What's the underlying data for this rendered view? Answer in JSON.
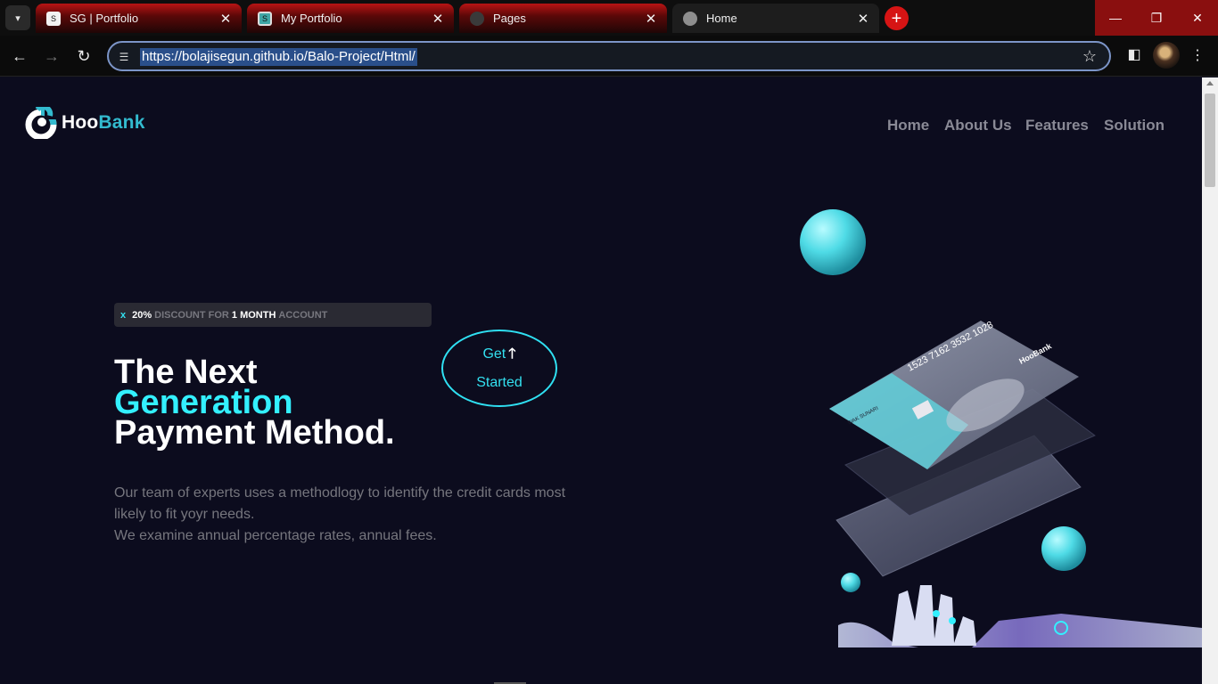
{
  "browser": {
    "tabs": [
      {
        "title": "SG | Portfolio",
        "style": "red"
      },
      {
        "title": "My Portfolio",
        "style": "red"
      },
      {
        "title": "Pages",
        "style": "red"
      },
      {
        "title": "Home",
        "style": "active"
      }
    ],
    "url": "https://bolajisegun.github.io/Balo-Project/Html/"
  },
  "site": {
    "logo": {
      "part1": "Hoo",
      "part2": "Bank"
    },
    "nav": [
      "Home",
      "About Us",
      "Features",
      "Solution"
    ],
    "badge": {
      "x": "x",
      "pct": "20%",
      "mid": "DISCOUNT FOR",
      "strong": "1 MONTH",
      "tail": "ACCOUNT"
    },
    "headline": {
      "line1": "The Next",
      "line2": "Generation",
      "line3": "Payment Method."
    },
    "cta": {
      "line1": "Get",
      "arrow": "🡑",
      "line2": "Started"
    },
    "description": {
      "line1": "Our team of experts uses a methodlogy to identify the credit cards most",
      "line2": "likely to fit yoyr needs.",
      "line3": "We examine annual percentage rates, annual fees."
    },
    "card": {
      "number": "1523 7162 3532 1028",
      "holder": "WAK SUNARI",
      "brand": "HooBank"
    }
  },
  "colors": {
    "background": "#0c0c1e",
    "accent": "#33f0ff",
    "nav": "#8a8a96"
  }
}
